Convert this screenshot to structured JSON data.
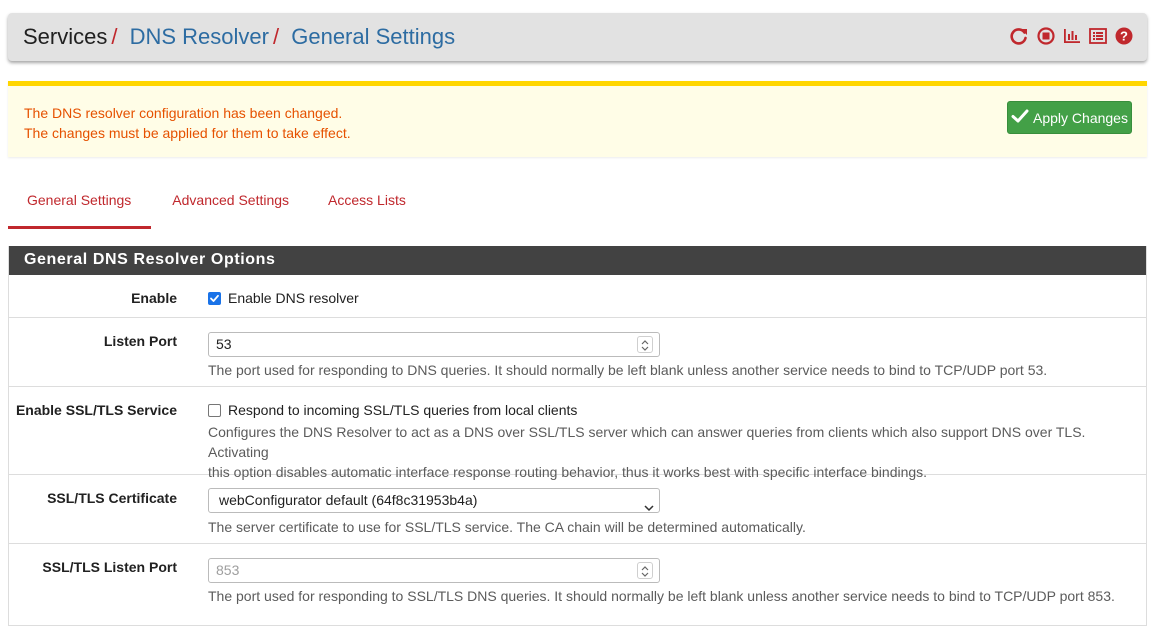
{
  "breadcrumb": {
    "root": "Services",
    "section": "DNS Resolver",
    "page": "General Settings",
    "separator": "/"
  },
  "header_icons": [
    "restart-icon",
    "stop-icon",
    "chart-icon",
    "log-list-icon",
    "help-icon"
  ],
  "alert": {
    "line1": "The DNS resolver configuration has been changed.",
    "line2": "The changes must be applied for them to take effect.",
    "apply_label": "Apply Changes"
  },
  "tabs": [
    {
      "label": "General Settings",
      "active": true
    },
    {
      "label": "Advanced Settings",
      "active": false
    },
    {
      "label": "Access Lists",
      "active": false
    }
  ],
  "panel": {
    "title": "General DNS Resolver Options",
    "enable": {
      "label": "Enable",
      "checkbox_label": "Enable DNS resolver",
      "checked": true
    },
    "listen_port": {
      "label": "Listen Port",
      "value": "53",
      "help": "The port used for responding to DNS queries. It should normally be left blank unless another service needs to bind to TCP/UDP port 53."
    },
    "ssl_service": {
      "label": "Enable SSL/TLS Service",
      "checkbox_label": "Respond to incoming SSL/TLS queries from local clients",
      "checked": false,
      "help1": "Configures the DNS Resolver to act as a DNS over SSL/TLS server which can answer queries from clients which also support DNS over TLS. Activating",
      "help2": "this option disables automatic interface response routing behavior, thus it works best with specific interface bindings."
    },
    "ssl_cert": {
      "label": "SSL/TLS Certificate",
      "selected": "webConfigurator default (64f8c31953b4a)",
      "help": "The server certificate to use for SSL/TLS service. The CA chain will be determined automatically."
    },
    "ssl_port": {
      "label": "SSL/TLS Listen Port",
      "placeholder": "853",
      "help": "The port used for responding to SSL/TLS DNS queries. It should normally be left blank unless another service needs to bind to TCP/UDP port 853."
    }
  },
  "colors": {
    "accent_red": "#c0282d",
    "link_blue": "#2d6ca2",
    "alert_bg": "#fffde7",
    "alert_border": "#ffd600",
    "alert_text": "#e65100",
    "apply_green": "#43a047",
    "panel_heading": "#424242"
  }
}
